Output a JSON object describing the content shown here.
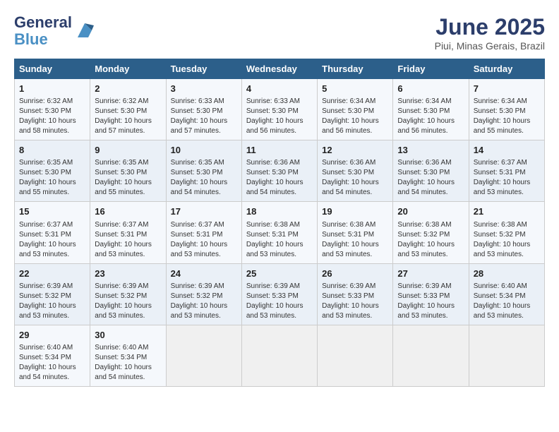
{
  "logo": {
    "line1": "General",
    "line2": "Blue"
  },
  "title": "June 2025",
  "subtitle": "Piui, Minas Gerais, Brazil",
  "days_of_week": [
    "Sunday",
    "Monday",
    "Tuesday",
    "Wednesday",
    "Thursday",
    "Friday",
    "Saturday"
  ],
  "weeks": [
    [
      {
        "day": 1,
        "info": "Sunrise: 6:32 AM\nSunset: 5:30 PM\nDaylight: 10 hours\nand 58 minutes."
      },
      {
        "day": 2,
        "info": "Sunrise: 6:32 AM\nSunset: 5:30 PM\nDaylight: 10 hours\nand 57 minutes."
      },
      {
        "day": 3,
        "info": "Sunrise: 6:33 AM\nSunset: 5:30 PM\nDaylight: 10 hours\nand 57 minutes."
      },
      {
        "day": 4,
        "info": "Sunrise: 6:33 AM\nSunset: 5:30 PM\nDaylight: 10 hours\nand 56 minutes."
      },
      {
        "day": 5,
        "info": "Sunrise: 6:34 AM\nSunset: 5:30 PM\nDaylight: 10 hours\nand 56 minutes."
      },
      {
        "day": 6,
        "info": "Sunrise: 6:34 AM\nSunset: 5:30 PM\nDaylight: 10 hours\nand 56 minutes."
      },
      {
        "day": 7,
        "info": "Sunrise: 6:34 AM\nSunset: 5:30 PM\nDaylight: 10 hours\nand 55 minutes."
      }
    ],
    [
      {
        "day": 8,
        "info": "Sunrise: 6:35 AM\nSunset: 5:30 PM\nDaylight: 10 hours\nand 55 minutes."
      },
      {
        "day": 9,
        "info": "Sunrise: 6:35 AM\nSunset: 5:30 PM\nDaylight: 10 hours\nand 55 minutes."
      },
      {
        "day": 10,
        "info": "Sunrise: 6:35 AM\nSunset: 5:30 PM\nDaylight: 10 hours\nand 54 minutes."
      },
      {
        "day": 11,
        "info": "Sunrise: 6:36 AM\nSunset: 5:30 PM\nDaylight: 10 hours\nand 54 minutes."
      },
      {
        "day": 12,
        "info": "Sunrise: 6:36 AM\nSunset: 5:30 PM\nDaylight: 10 hours\nand 54 minutes."
      },
      {
        "day": 13,
        "info": "Sunrise: 6:36 AM\nSunset: 5:30 PM\nDaylight: 10 hours\nand 54 minutes."
      },
      {
        "day": 14,
        "info": "Sunrise: 6:37 AM\nSunset: 5:31 PM\nDaylight: 10 hours\nand 53 minutes."
      }
    ],
    [
      {
        "day": 15,
        "info": "Sunrise: 6:37 AM\nSunset: 5:31 PM\nDaylight: 10 hours\nand 53 minutes."
      },
      {
        "day": 16,
        "info": "Sunrise: 6:37 AM\nSunset: 5:31 PM\nDaylight: 10 hours\nand 53 minutes."
      },
      {
        "day": 17,
        "info": "Sunrise: 6:37 AM\nSunset: 5:31 PM\nDaylight: 10 hours\nand 53 minutes."
      },
      {
        "day": 18,
        "info": "Sunrise: 6:38 AM\nSunset: 5:31 PM\nDaylight: 10 hours\nand 53 minutes."
      },
      {
        "day": 19,
        "info": "Sunrise: 6:38 AM\nSunset: 5:31 PM\nDaylight: 10 hours\nand 53 minutes."
      },
      {
        "day": 20,
        "info": "Sunrise: 6:38 AM\nSunset: 5:32 PM\nDaylight: 10 hours\nand 53 minutes."
      },
      {
        "day": 21,
        "info": "Sunrise: 6:38 AM\nSunset: 5:32 PM\nDaylight: 10 hours\nand 53 minutes."
      }
    ],
    [
      {
        "day": 22,
        "info": "Sunrise: 6:39 AM\nSunset: 5:32 PM\nDaylight: 10 hours\nand 53 minutes."
      },
      {
        "day": 23,
        "info": "Sunrise: 6:39 AM\nSunset: 5:32 PM\nDaylight: 10 hours\nand 53 minutes."
      },
      {
        "day": 24,
        "info": "Sunrise: 6:39 AM\nSunset: 5:32 PM\nDaylight: 10 hours\nand 53 minutes."
      },
      {
        "day": 25,
        "info": "Sunrise: 6:39 AM\nSunset: 5:33 PM\nDaylight: 10 hours\nand 53 minutes."
      },
      {
        "day": 26,
        "info": "Sunrise: 6:39 AM\nSunset: 5:33 PM\nDaylight: 10 hours\nand 53 minutes."
      },
      {
        "day": 27,
        "info": "Sunrise: 6:39 AM\nSunset: 5:33 PM\nDaylight: 10 hours\nand 53 minutes."
      },
      {
        "day": 28,
        "info": "Sunrise: 6:40 AM\nSunset: 5:34 PM\nDaylight: 10 hours\nand 53 minutes."
      }
    ],
    [
      {
        "day": 29,
        "info": "Sunrise: 6:40 AM\nSunset: 5:34 PM\nDaylight: 10 hours\nand 54 minutes."
      },
      {
        "day": 30,
        "info": "Sunrise: 6:40 AM\nSunset: 5:34 PM\nDaylight: 10 hours\nand 54 minutes."
      },
      {
        "day": null,
        "info": ""
      },
      {
        "day": null,
        "info": ""
      },
      {
        "day": null,
        "info": ""
      },
      {
        "day": null,
        "info": ""
      },
      {
        "day": null,
        "info": ""
      }
    ]
  ]
}
